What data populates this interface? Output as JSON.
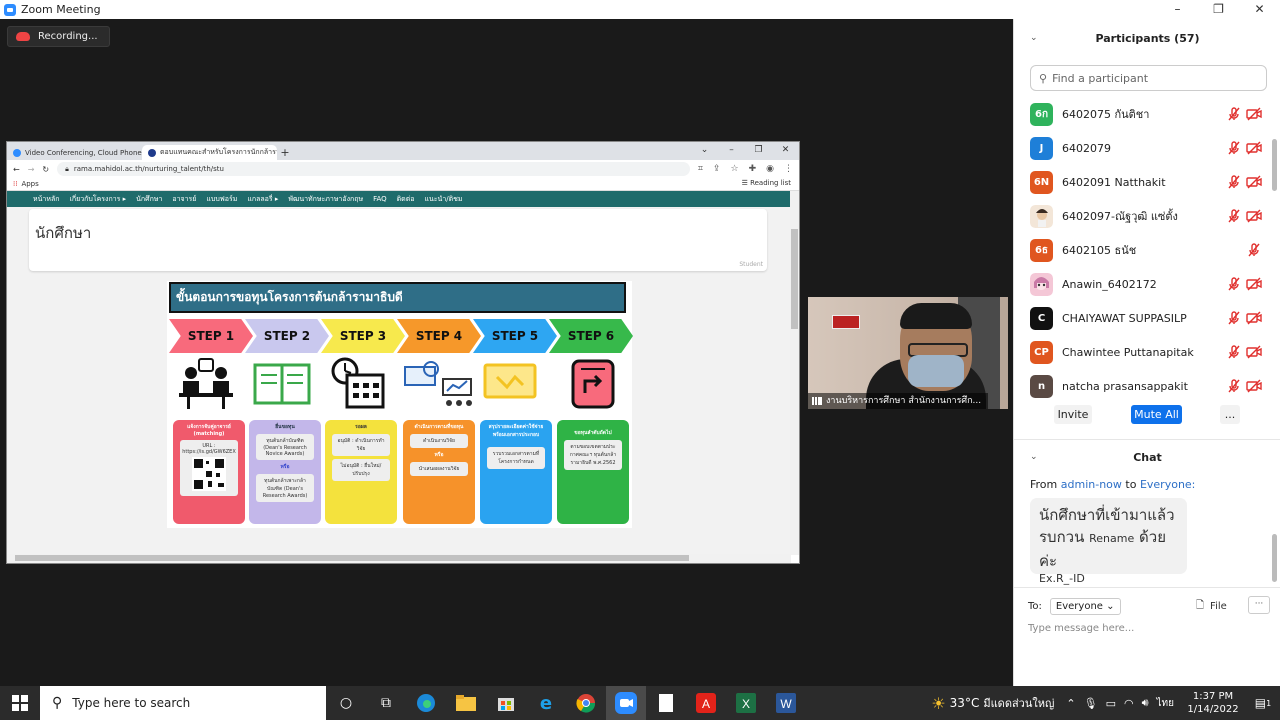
{
  "window": {
    "title": "Zoom Meeting",
    "controls": [
      "–",
      "❐",
      "✕"
    ]
  },
  "recording": {
    "label": "Recording..."
  },
  "browser": {
    "tabs": [
      {
        "label": "Video Conferencing, Cloud Phone...",
        "favicon_color": "#2d8cff"
      },
      {
        "label": "ตอบแทนคณะสำหรับโครงการนักกล้าราชการ...",
        "favicon_color": "#1f3b8c"
      }
    ],
    "new_tab": "+",
    "url": "rama.mahidol.ac.th/nurturing_talent/th/stu",
    "bookmarks_label": "Apps",
    "reading_list": "Reading list",
    "nav_items": [
      "หน้าหลัก",
      "เกี่ยวกับโครงการ ▸",
      "นักศึกษา",
      "อาจารย์",
      "แบบฟอร์ม",
      "แกลลอรี่ ▸",
      "พัฒนาทักษะภาษาอังกฤษ",
      "FAQ",
      "ติดต่อ",
      "แนะนำ/ติชม"
    ],
    "page_heading": "นักศึกษา",
    "page_sub": "Student",
    "infographic": {
      "title": "ขั้นตอนการขอทุนโครงการต้นกล้ารามาธิบดี",
      "steps": [
        {
          "label": "STEP 1",
          "color": "#f86a7c"
        },
        {
          "label": "STEP 2",
          "color": "#c9c8ee"
        },
        {
          "label": "STEP 3",
          "color": "#f7e94d"
        },
        {
          "label": "STEP 4",
          "color": "#f6982a"
        },
        {
          "label": "STEP 5",
          "color": "#2ea6f2"
        },
        {
          "label": "STEP 6",
          "color": "#37b94b"
        }
      ],
      "boxes": [
        {
          "head": "แจ้งการจับคู่อาจารย์ (matching)",
          "lines": [
            "URL :",
            "https://is.gd/GW6ZEX"
          ],
          "color": "#f05a6c"
        },
        {
          "head": "ยื่นขอทุน",
          "lines": [
            "ทุนต้นกล้าบัณฑิต (Dean's Research Novice Awards)",
            "หรือ",
            "ทุนต้นกล้าเพาะกล้าบัณฑิต (Dean's Research Awards)"
          ],
          "color": "#c3b7ea"
        },
        {
          "head": "รอผล",
          "lines": [
            "อนุมัติ : ดำเนินการทำวิจัย",
            "ไม่อนุมัติ : ยื่นใหม่/ปรับปรุง"
          ],
          "color": "#f4e23d"
        },
        {
          "head": "ดำเนินการตามที่ขอทุน",
          "lines": [
            "ดำเนินงานวิจัย",
            "หรือ",
            "นำเสนอผลงานวิจัย"
          ],
          "color": "#f6922a"
        },
        {
          "head": "สรุปรายละเอียดค่าใช้จ่ายพร้อมเอกสารประกอบ",
          "lines": [
            "รวบรวมเอกสารตามที่โครงการกำหนด"
          ],
          "color": "#2aa3f0"
        },
        {
          "head": "ขอทุนลำดับถัดไป",
          "lines": [
            "ตามขอบเขตตามประกาศคณะฯ ทุนต้นกล้ารามาธิบดี พ.ศ.2562"
          ],
          "color": "#2fb346"
        }
      ]
    }
  },
  "video_tile": {
    "name": "งานบริหารการศึกษา สำนักงานการศึก..."
  },
  "participants": {
    "title": "Participants (57)",
    "search_placeholder": "Find a participant",
    "list": [
      {
        "avatar": "6ก",
        "color": "#2fb35c",
        "name": "6402075 กันติชา",
        "video_off": true
      },
      {
        "avatar": "J",
        "color": "#1e7fd8",
        "name": "6402079",
        "video_off": true
      },
      {
        "avatar": "6N",
        "color": "#e0561f",
        "name": "6402091 Natthakit",
        "video_off": true
      },
      {
        "avatar": "img",
        "color": "#f3e6d8",
        "name": "6402097-ณัฐวุฒิ แซ่ตั้ง",
        "video_off": true
      },
      {
        "avatar": "6ธ",
        "color": "#e0561f",
        "name": "6402105 ธนัช",
        "video_off": false
      },
      {
        "avatar": "img",
        "color": "#f4c7d6",
        "name": "Anawin_6402172",
        "video_off": true
      },
      {
        "avatar": "C",
        "color": "#111111",
        "name": "CHAIYAWAT SUPPASILP",
        "video_off": true
      },
      {
        "avatar": "CP",
        "color": "#e0561f",
        "name": "Chawintee Puttanapitak",
        "video_off": true
      },
      {
        "avatar": "n",
        "color": "#5a4a44",
        "name": "natcha prasansappakit",
        "video_off": true
      }
    ],
    "buttons": {
      "invite": "Invite",
      "mute_all": "Mute All",
      "more": "..."
    }
  },
  "chat": {
    "title": "Chat",
    "from_label": "From",
    "from_user": "admin-now",
    "to_label": "to",
    "to_user": "Everyone:",
    "message_line1": "นักศึกษาที่เข้ามาแล้ว",
    "message_line2_a": "รบกวน",
    "message_line2_b": "Rename",
    "message_line2_c": "ด้วยค่ะ",
    "message_line3": "Ex.R_-ID",
    "to_prefix": "To:",
    "recipient": "Everyone",
    "file_label": "File",
    "more": "···",
    "input_placeholder": "Type message here..."
  },
  "taskbar": {
    "search_placeholder": "Type here to search",
    "weather": "33°C",
    "weather_desc": "มีแดดส่วนใหญ่",
    "lang": "ไทย",
    "time": "1:37 PM",
    "date": "1/14/2022",
    "notifications": "1"
  }
}
